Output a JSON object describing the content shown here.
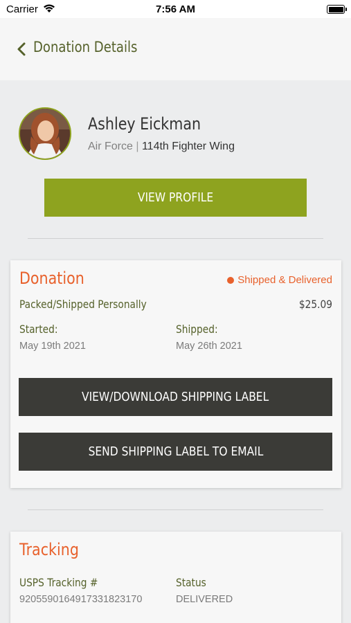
{
  "status_bar": {
    "carrier": "Carrier",
    "time": "7:56 AM"
  },
  "header": {
    "title": "Donation Details"
  },
  "profile": {
    "name": "Ashley Eickman",
    "branch": "Air Force",
    "separator": "|",
    "unit": "114th Fighter Wing",
    "view_profile_label": "VIEW PROFILE"
  },
  "donation": {
    "title": "Donation",
    "status": "Shipped & Delivered",
    "method": "Packed/Shipped Personally",
    "amount": "$25.09",
    "started_label": "Started:",
    "started_date": "May 19th 2021",
    "shipped_label": "Shipped:",
    "shipped_date": "May 26th 2021",
    "view_label_button": "VIEW/DOWNLOAD SHIPPING LABEL",
    "email_label_button": "SEND SHIPPING LABEL TO EMAIL"
  },
  "tracking": {
    "title": "Tracking",
    "number_label": "USPS Tracking #",
    "number_value": "9205590164917331823170",
    "status_label": "Status",
    "status_value": "DELIVERED"
  },
  "colors": {
    "accent_green": "#8ea31f",
    "olive_text": "#55612a",
    "orange": "#e8612c",
    "dark_button": "#3b3b37"
  }
}
